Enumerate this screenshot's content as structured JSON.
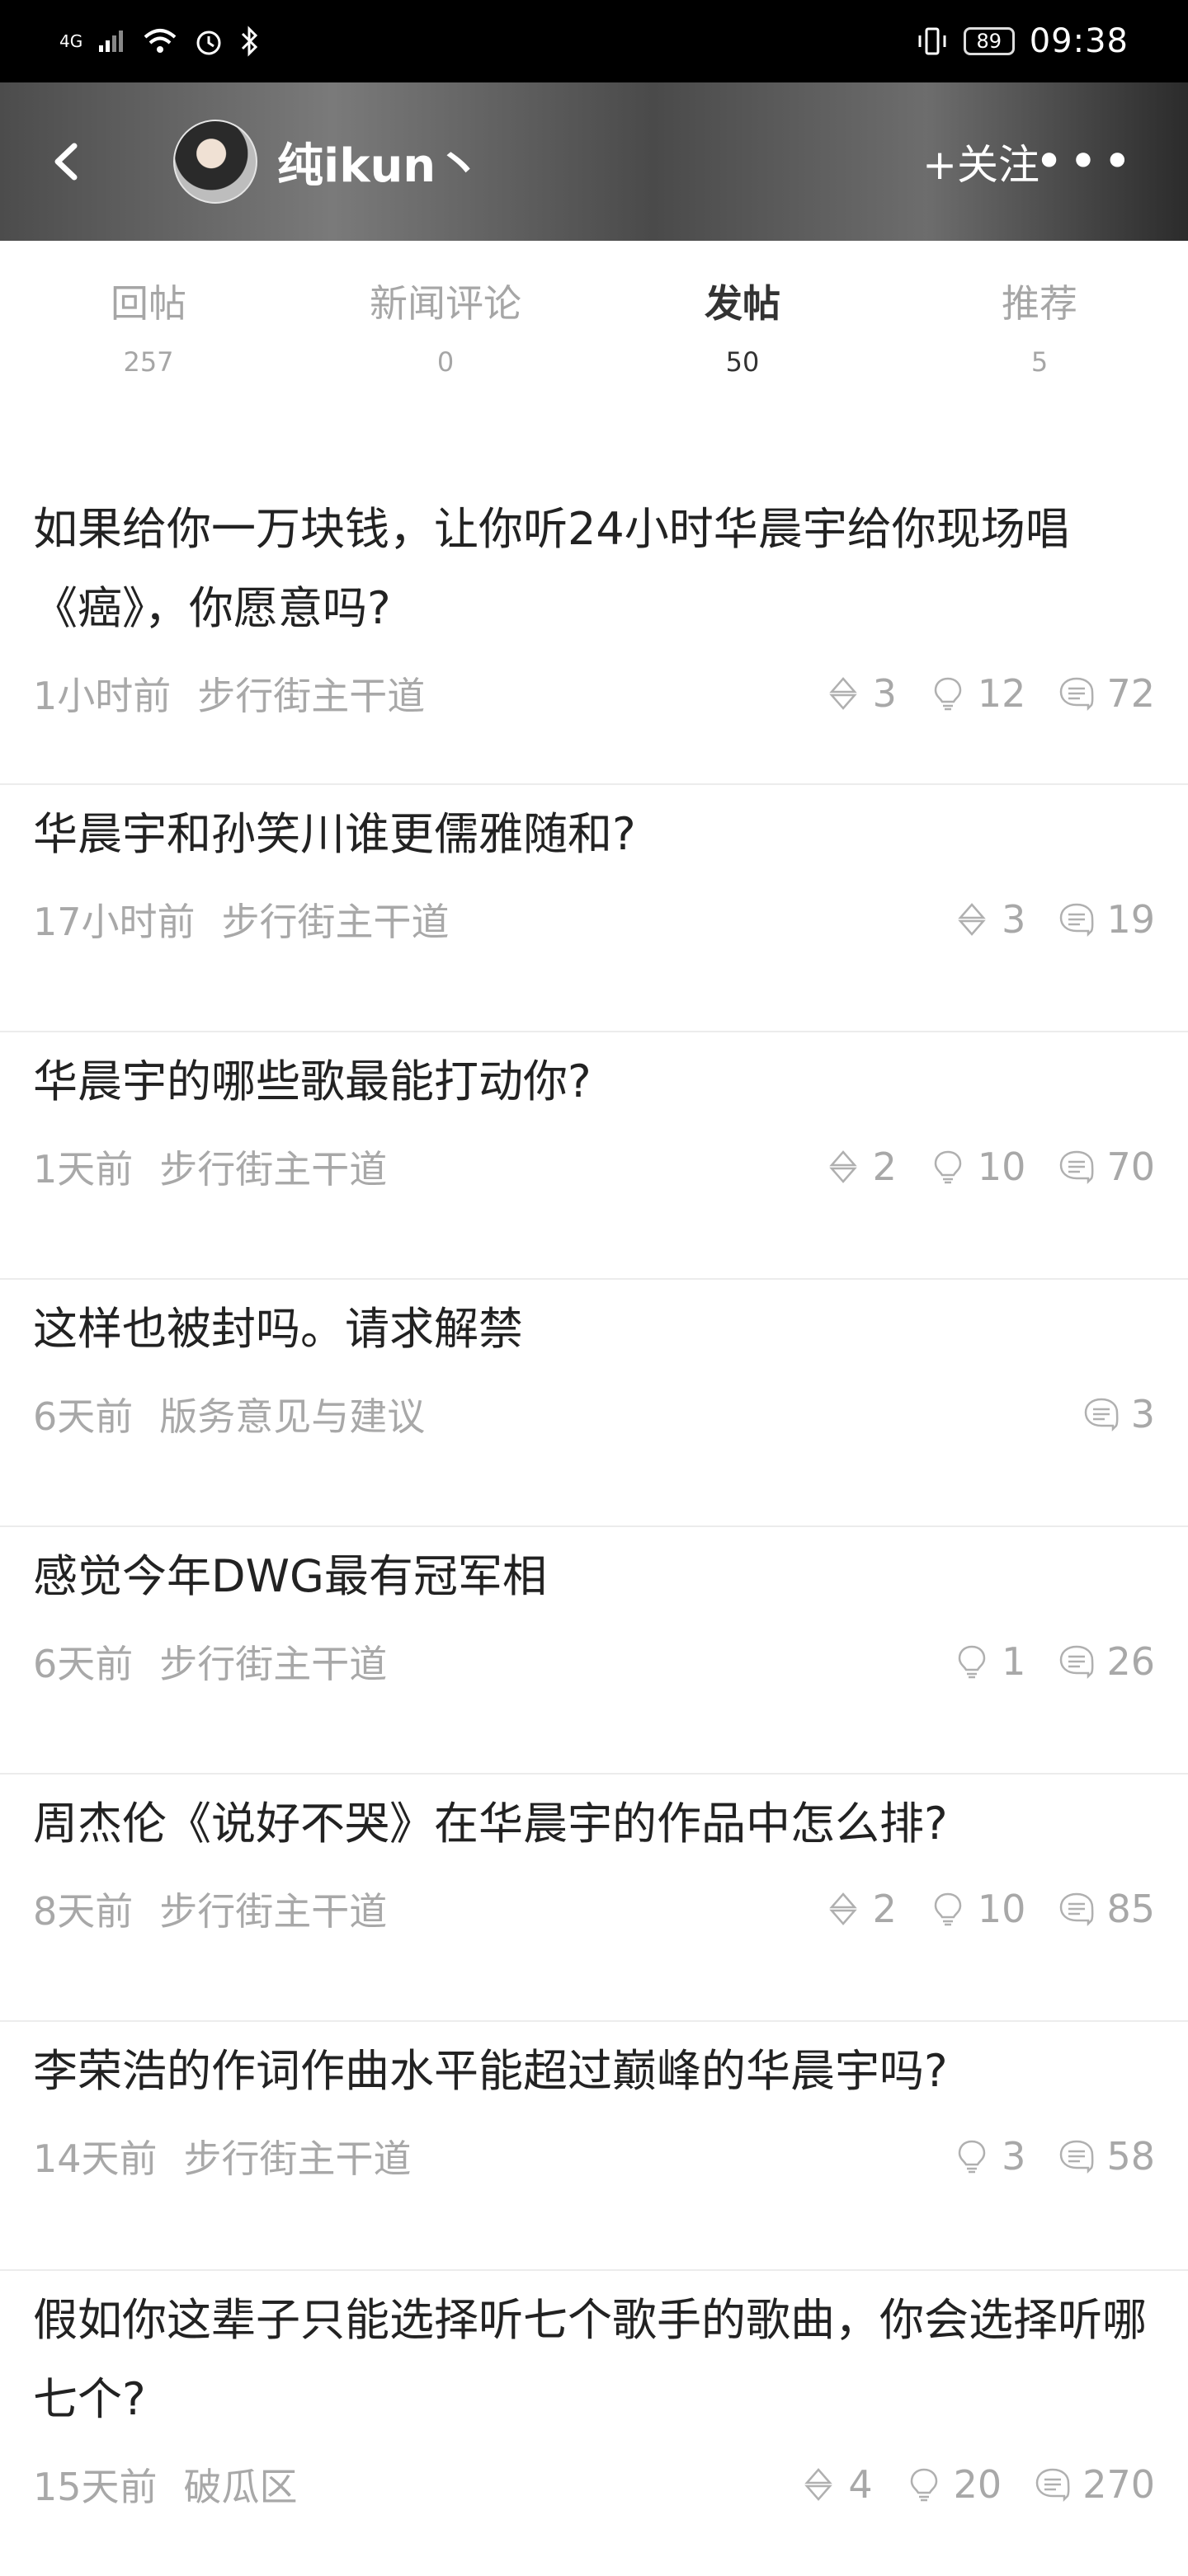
{
  "status_bar": {
    "network": "4G",
    "battery": "89",
    "time": "09:38"
  },
  "header": {
    "username": "纯ikun丶",
    "follow_label": "+关注",
    "more_label": "•••"
  },
  "tabs": [
    {
      "label": "回帖",
      "count": "257"
    },
    {
      "label": "新闻评论",
      "count": "0"
    },
    {
      "label": "发帖",
      "count": "50"
    },
    {
      "label": "推荐",
      "count": "5"
    }
  ],
  "posts": [
    {
      "title": "如果给你一万块钱，让你听24小时华晨宇给你现场唱《癌》，你愿意吗?",
      "time": "1小时前",
      "forum": "步行街主干道",
      "likes": "3",
      "lights": "12",
      "replies": "72"
    },
    {
      "title": "华晨宇和孙笑川谁更儒雅随和?",
      "time": "17小时前",
      "forum": "步行街主干道",
      "likes": "3",
      "replies": "19"
    },
    {
      "title": "华晨宇的哪些歌最能打动你?",
      "time": "1天前",
      "forum": "步行街主干道",
      "likes": "2",
      "lights": "10",
      "replies": "70"
    },
    {
      "title": "这样也被封吗。请求解禁",
      "time": "6天前",
      "forum": "版务意见与建议",
      "replies": "3"
    },
    {
      "title": "感觉今年DWG最有冠军相",
      "time": "6天前",
      "forum": "步行街主干道",
      "lights": "1",
      "replies": "26"
    },
    {
      "title": "周杰伦《说好不哭》在华晨宇的作品中怎么排?",
      "time": "8天前",
      "forum": "步行街主干道",
      "likes": "2",
      "lights": "10",
      "replies": "85"
    },
    {
      "title": "李荣浩的作词作曲水平能超过巅峰的华晨宇吗?",
      "time": "14天前",
      "forum": "步行街主干道",
      "lights": "3",
      "replies": "58"
    },
    {
      "title": "假如你这辈子只能选择听七个歌手的歌曲，你会选择听哪七个?",
      "time": "15天前",
      "forum": "破瓜区",
      "likes": "4",
      "lights": "20",
      "replies": "270"
    }
  ]
}
